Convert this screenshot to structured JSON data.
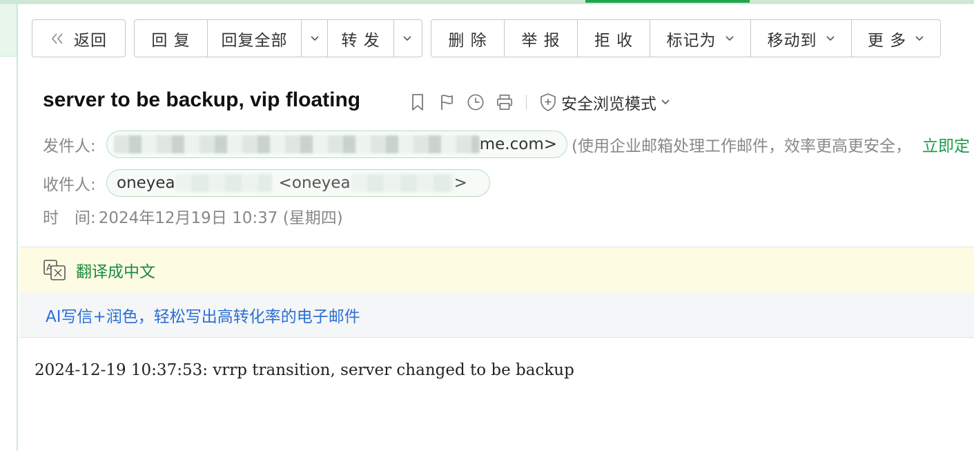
{
  "toolbar": {
    "back": "返回",
    "back_icon": "double-chevron-left",
    "reply": "回 复",
    "reply_all": "回复全部",
    "forward": "转 发",
    "delete": "删 除",
    "report": "举 报",
    "reject": "拒 收",
    "mark_as": "标记为",
    "move_to": "移动到",
    "more": "更 多"
  },
  "header": {
    "subject": "server to be backup, vip floating",
    "icons": [
      "bookmark-icon",
      "flag-icon",
      "clock-icon",
      "print-icon",
      "shield-icon"
    ],
    "safe_mode": "安全浏览模式",
    "from_label": "发件人:",
    "from_visible": "me.com>",
    "from_hint": "(使用企业邮箱处理工作邮件，效率更高更安全，",
    "from_hint_link": "立即定",
    "to_label": "收件人:",
    "to_name": "oneyea",
    "to_email_visible": "<oneyea",
    "to_close": ">",
    "time_label": "时　间:",
    "time_value": "2024年12月19日 10:37 (星期四)"
  },
  "translate": {
    "label": "翻译成中文",
    "icon": "translate-icon"
  },
  "ai": {
    "label": "AI写信+润色，轻松写出高转化率的电子邮件"
  },
  "body": {
    "text": "2024-12-19 10:37:53: vrrp transition, server changed to be backup"
  },
  "colors": {
    "accent_green": "#1fa64a",
    "link_green": "#1a9b46",
    "ai_blue": "#2a6fd6",
    "translate_bg": "#fefbe3"
  }
}
